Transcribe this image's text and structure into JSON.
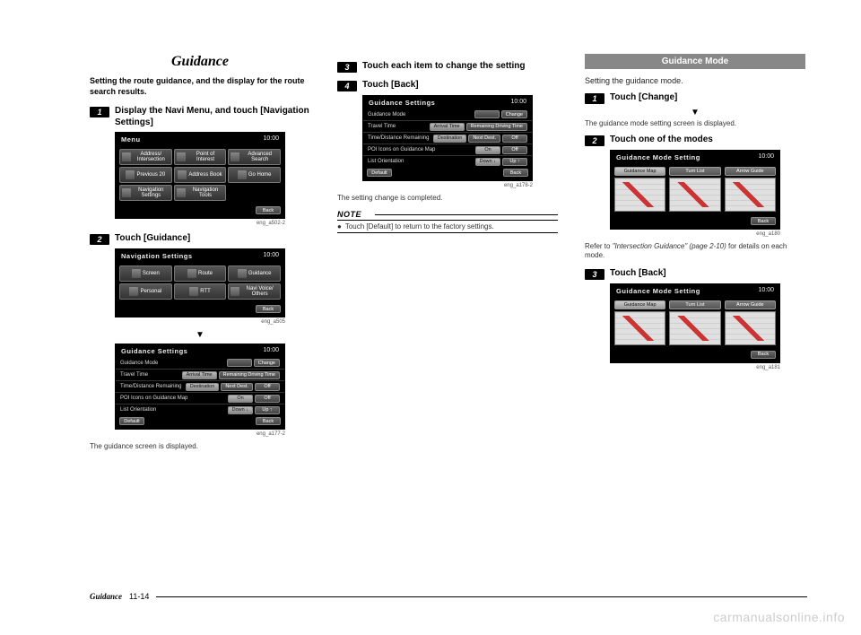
{
  "page": {
    "footer_title": "Guidance",
    "footer_page": "11-14",
    "watermark": "carmanualsonline.info"
  },
  "col1": {
    "title": "Guidance",
    "intro": "Setting the route guidance, and the display for the route search results.",
    "step1": {
      "num": "1",
      "text": "Display the Navi Menu, and touch [Navigation Settings]"
    },
    "shot1": {
      "title": "Menu",
      "clock": "10:00",
      "buttons": [
        "Address/\nIntersection",
        "Point of\nInterest",
        "Advanced\nSearch",
        "Previous\n20",
        "Address\nBook",
        "Go Home",
        "Navigation\nSettings",
        "Navigation\nTools"
      ],
      "back": "Back",
      "caption": "eng_a502-2"
    },
    "step2": {
      "num": "2",
      "text": "Touch [Guidance]"
    },
    "shot2": {
      "title": "Navigation Settings",
      "clock": "10:00",
      "buttons": [
        "Screen",
        "Route",
        "Guidance",
        "Personal",
        "RTT",
        "Navi Voice/\nOthers"
      ],
      "back": "Back",
      "caption": "eng_a505"
    },
    "shot3": {
      "title": "Guidance Settings",
      "clock": "10:00",
      "rows": [
        {
          "label": "Guidance Mode",
          "btns": [
            "",
            "Change"
          ]
        },
        {
          "label": "Travel Time",
          "btns": [
            "Arrival Time",
            "Remaining Driving Time"
          ],
          "sel": 0
        },
        {
          "label": "Time/Distance Remaining",
          "btns": [
            "Destination",
            "Next Dest.",
            "Off"
          ],
          "sel": 0
        },
        {
          "label": "POI Icons on Guidance Map",
          "btns": [
            "On",
            "Off"
          ],
          "sel": 0
        },
        {
          "label": "List Orientation",
          "btns": [
            "Down ↓",
            "Up ↑"
          ],
          "sel": 0
        }
      ],
      "default": "Default",
      "back": "Back",
      "caption": "eng_a177-2"
    },
    "caption3": "The guidance screen is displayed."
  },
  "col2": {
    "step3": {
      "num": "3",
      "text": "Touch each item to change the setting"
    },
    "step4": {
      "num": "4",
      "text": "Touch [Back]"
    },
    "shot4": {
      "title": "Guidance Settings",
      "clock": "10:00",
      "rows": [
        {
          "label": "Guidance Mode",
          "btns": [
            "",
            "Change"
          ]
        },
        {
          "label": "Travel Time",
          "btns": [
            "Arrival Time",
            "Remaining Driving Time"
          ],
          "sel": 0
        },
        {
          "label": "Time/Distance Remaining",
          "btns": [
            "Destination",
            "Next Dest.",
            "Off"
          ],
          "sel": 0
        },
        {
          "label": "POI Icons on Guidance Map",
          "btns": [
            "On",
            "Off"
          ],
          "sel": 0
        },
        {
          "label": "List Orientation",
          "btns": [
            "Down ↓",
            "Up ↑"
          ],
          "sel": 0
        }
      ],
      "default": "Default",
      "back": "Back",
      "caption": "eng_a178-2"
    },
    "caption4": "The setting change is completed.",
    "note_label": "NOTE",
    "note_text": "Touch [Default] to return to the factory settings."
  },
  "col3": {
    "heading": "Guidance Mode",
    "intro": "Setting the guidance mode.",
    "step1": {
      "num": "1",
      "text": "Touch [Change]"
    },
    "caption1": "The guidance mode setting screen is displayed.",
    "step2": {
      "num": "2",
      "text": "Touch one of the modes"
    },
    "shot5": {
      "title": "Guidance Mode Setting",
      "clock": "10:00",
      "modes": [
        "Guidance Map",
        "Turn List",
        "Arrow Guide"
      ],
      "back": "Back",
      "caption": "eng_a180"
    },
    "ref_pre": "Refer to ",
    "ref_italic": "\"Intersection Guidance\" (page 2-10)",
    "ref_post": " for details on each mode.",
    "step3": {
      "num": "3",
      "text": "Touch [Back]"
    },
    "shot6": {
      "title": "Guidance Mode Setting",
      "clock": "10:00",
      "modes": [
        "Guidance Map",
        "Turn List",
        "Arrow Guide"
      ],
      "back": "Back",
      "caption": "eng_a181"
    }
  }
}
